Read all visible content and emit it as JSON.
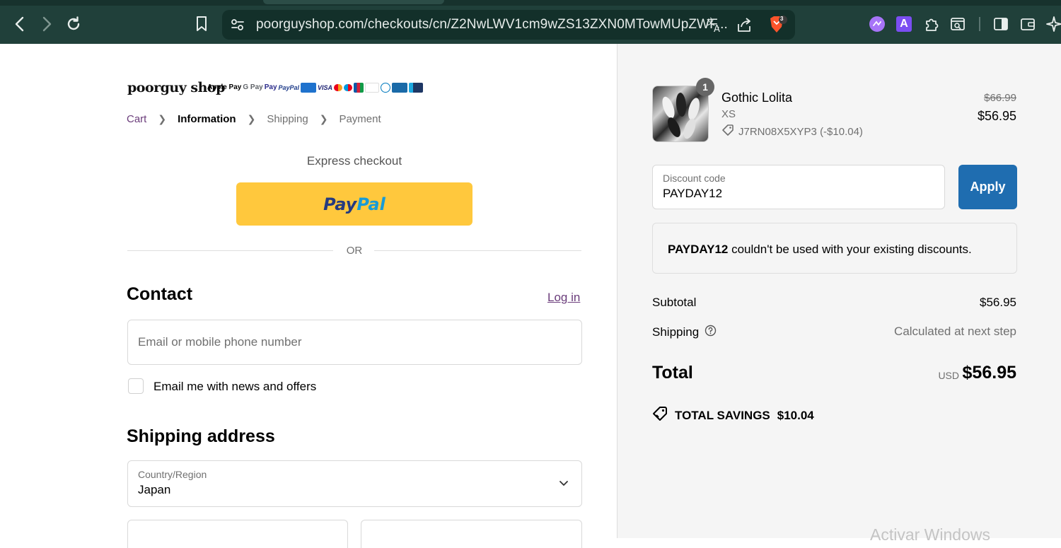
{
  "browser": {
    "url": "poorguyshop.com/checkouts/cn/Z2NwLWV1cm9wZS13ZXN0MTowMUpZWF...",
    "brave_badge_count": "3",
    "extension_letter": "A",
    "icons": [
      "back-icon",
      "forward-icon",
      "reload-icon",
      "bookmark-icon",
      "site-settings-icon",
      "translate-icon",
      "share-icon",
      "brave-shield-icon",
      "extension-icon",
      "puzzle-icon",
      "reader-icon",
      "sidebar-icon",
      "wallet-icon",
      "leo-icon"
    ]
  },
  "store": {
    "logo_text": "poorguy shop",
    "payment_methods": [
      "Apple Pay",
      "G Pay",
      "Pay",
      "PayPal",
      "American Express",
      "VISA",
      "Mastercard",
      "Maestro",
      "JCB",
      "Discover",
      "Diners Club",
      "UnionPay",
      "Bancontact"
    ]
  },
  "breadcrumb": {
    "items": [
      "Cart",
      "Information",
      "Shipping",
      "Payment"
    ]
  },
  "express": {
    "title": "Express checkout",
    "paypal_part1": "Pay",
    "paypal_part2": "Pal",
    "or_label": "OR"
  },
  "contact": {
    "title": "Contact",
    "login_label": "Log in",
    "email_placeholder": "Email or mobile phone number",
    "newsletter_label": "Email me with news and offers"
  },
  "shipping": {
    "title": "Shipping address",
    "country_label": "Country/Region",
    "country_value": "Japan"
  },
  "summary": {
    "product": {
      "quantity": "1",
      "name": "Gothic Lolita",
      "variant": "XS",
      "discount_code": "J7RN08X5XYP3 (-$10.04)",
      "original_price": "$66.99",
      "price": "$56.95"
    },
    "discount_field": {
      "label": "Discount code",
      "value": "PAYDAY12"
    },
    "apply_label": "Apply",
    "notice": {
      "code": "PAYDAY12",
      "message": " couldn't be used with your existing discounts."
    },
    "subtotal_label": "Subtotal",
    "subtotal_value": "$56.95",
    "shipping_label": "Shipping",
    "shipping_value": "Calculated at next step",
    "total_label": "Total",
    "currency": "USD",
    "total_value": "$56.95",
    "savings_label": "TOTAL SAVINGS",
    "savings_value": "$10.04"
  },
  "os": {
    "watermark": "Activar Windows"
  },
  "colors": {
    "chrome_bg": "#20403a",
    "paypal_yellow": "#ffc83d",
    "apply_blue": "#1f6db0",
    "link_purple": "#6b3d7b"
  }
}
